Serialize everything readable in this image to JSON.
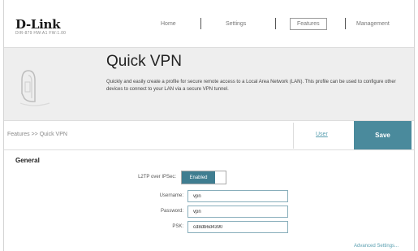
{
  "brand": {
    "name": "D-Link",
    "model": "DIR-879 HW:A1 FW:1.00"
  },
  "nav": {
    "home": "Home",
    "settings": "Settings",
    "features": "Features",
    "management": "Management"
  },
  "banner": {
    "title": "Quick VPN",
    "description": "Quickly and easily create a profile for secure remote access to a Local Area Network (LAN). This profile can be used to configure other devices to connect to your LAN via a secure VPN tunnel."
  },
  "toolbar": {
    "breadcrumb": "Features >> Quick VPN",
    "user_label": "User",
    "save_label": "Save"
  },
  "general": {
    "title": "General",
    "l2tp_label": "L2TP over IPSec:",
    "l2tp_value": "Enabled",
    "username_label": "Username:",
    "username_value": "vpn",
    "password_label": "Password:",
    "password_value": "vpn",
    "psk_label": "PSK:",
    "psk_value": "cd8db6d4390",
    "advanced_link": "Advanced Settings..."
  },
  "colors": {
    "accent": "#4a8a9c",
    "toggle_on": "#3f7d90",
    "link": "#5a9fb0",
    "banner_bg": "#eeeeee"
  }
}
